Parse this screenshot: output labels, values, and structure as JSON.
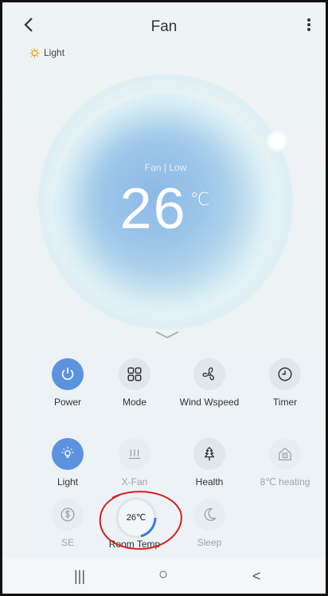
{
  "header": {
    "title": "Fan",
    "back_icon": "chevron-left-icon",
    "more_icon": "more-vertical-icon"
  },
  "indicator": {
    "icon": "bulb-icon",
    "label": "Light"
  },
  "dial": {
    "mode": "Fan | Low",
    "temperature": "26",
    "unit": "℃"
  },
  "controls_row1": [
    {
      "label": "Power",
      "icon": "power-icon",
      "active": true
    },
    {
      "label": "Mode",
      "icon": "grid-icon",
      "active": false
    },
    {
      "label": "Wind Wspeed",
      "icon": "fan-icon",
      "active": false
    },
    {
      "label": "Timer",
      "icon": "clock-icon",
      "active": false
    }
  ],
  "controls_row2": [
    {
      "label": "Light",
      "icon": "bulb-icon",
      "active": true
    },
    {
      "label": "X-Fan",
      "icon": "heat-waves-icon",
      "active": false,
      "disabled": true
    },
    {
      "label": "Health",
      "icon": "tree-icon",
      "active": false
    },
    {
      "label": "8℃ heating",
      "icon": "house-8-icon",
      "active": false,
      "disabled": true
    }
  ],
  "controls_row3": [
    {
      "label": "SE",
      "icon": "dollar-icon",
      "disabled": true
    },
    {
      "label": "Room Temp",
      "value": "26℃"
    },
    {
      "label": "Sleep",
      "icon": "moon-icon",
      "disabled": true
    }
  ],
  "navbar": {
    "recents": "|||",
    "home": "○",
    "back": "<"
  },
  "colors": {
    "accent": "#5b93df",
    "annotation": "#d42020"
  }
}
